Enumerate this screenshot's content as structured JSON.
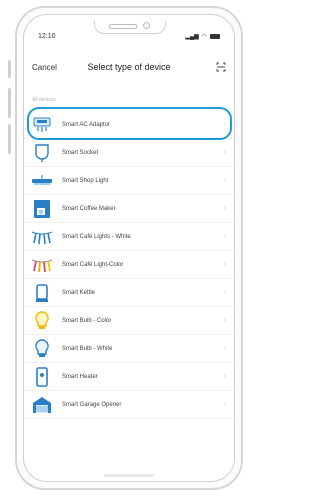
{
  "status_bar": {
    "time": "12:10"
  },
  "nav": {
    "cancel_label": "Cancel",
    "title": "Select type of device"
  },
  "section_label": "All devices",
  "devices": [
    {
      "label": "Smart AC Adaptor",
      "icon": "ac-adaptor-icon",
      "selected": true
    },
    {
      "label": "Smart Socket",
      "icon": "socket-icon"
    },
    {
      "label": "Smart Shop Light",
      "icon": "shop-light-icon"
    },
    {
      "label": "Smart Coffee Maker",
      "icon": "coffee-maker-icon"
    },
    {
      "label": "Smart Café Lights - White",
      "icon": "cafe-lights-white-icon"
    },
    {
      "label": "Smart Café Light-Color",
      "icon": "cafe-lights-color-icon"
    },
    {
      "label": "Smart Kettle",
      "icon": "kettle-icon"
    },
    {
      "label": "Smart Bulb - Color",
      "icon": "bulb-color-icon"
    },
    {
      "label": "Smart Bulb - White",
      "icon": "bulb-white-icon"
    },
    {
      "label": "Smart Heater",
      "icon": "heater-icon"
    },
    {
      "label": "Smart Garage Opener",
      "icon": "garage-opener-icon"
    }
  ],
  "colors": {
    "accent": "#1f9bd6",
    "icon_blue": "#2a7fc4"
  }
}
